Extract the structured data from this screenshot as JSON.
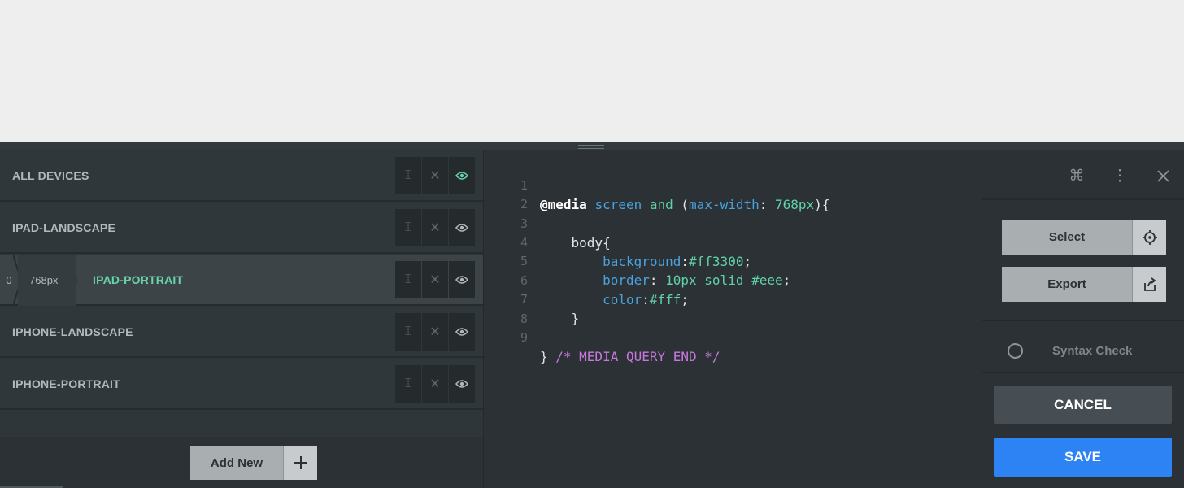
{
  "devices": [
    {
      "label": "ALL DEVICES",
      "active": false
    },
    {
      "label": "IPAD-LANDSCAPE",
      "active": false
    },
    {
      "label": "IPAD-PORTRAIT",
      "active": true,
      "crumbs": [
        "0",
        "768px"
      ]
    },
    {
      "label": "IPHONE-LANDSCAPE",
      "active": false
    },
    {
      "label": "IPHONE-PORTRAIT",
      "active": false
    }
  ],
  "add_new": {
    "label": "Add New",
    "icon": "plus-icon"
  },
  "editor": {
    "line_numbers": [
      "1",
      "2",
      "3",
      "4",
      "5",
      "6",
      "7",
      "8",
      "9"
    ],
    "lines": [
      {
        "at": "@media",
        "t1": " ",
        "kw1": "screen",
        "t2": " ",
        "kw2": "and",
        "t3": " (",
        "prop": "max-width",
        "t4": ": ",
        "val": "768px",
        "t5": "){"
      },
      {},
      {
        "sel": "    body{"
      },
      {
        "indent": "        ",
        "prop": "background",
        "sep": ":",
        "val": "#ff3300",
        "end": ";"
      },
      {
        "indent": "        ",
        "prop": "border",
        "sep": ": ",
        "val": "10px solid #eee",
        "end": ";"
      },
      {
        "indent": "        ",
        "prop": "color",
        "sep": ":",
        "val": "#fff",
        "end": ";"
      },
      {
        "sel": "    }"
      },
      {},
      {
        "close": "} ",
        "comment": "/* MEDIA QUERY END */"
      }
    ]
  },
  "right": {
    "icons": [
      "command-icon",
      "more-vertical-icon",
      "close-icon"
    ],
    "select_label": "Select",
    "export_label": "Export",
    "syntax_label": "Syntax Check",
    "cancel_label": "CANCEL",
    "save_label": "SAVE"
  },
  "colors": {
    "accent_green": "#69d3a8",
    "save_blue": "#2d83f3",
    "panel_bg": "#2b3134"
  }
}
